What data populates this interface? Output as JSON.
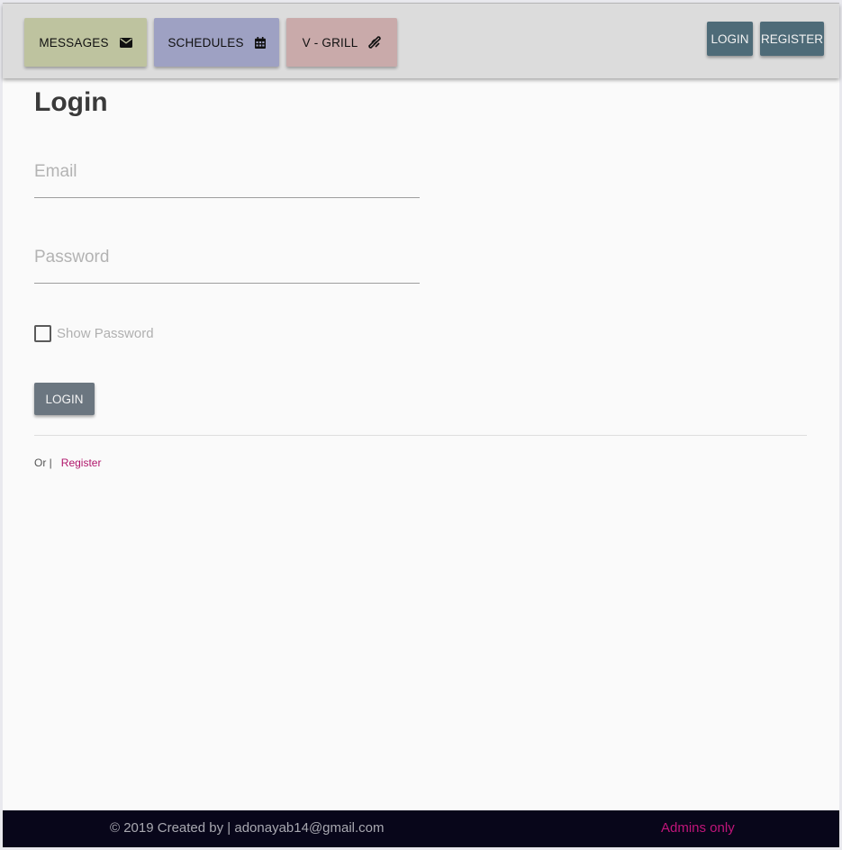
{
  "nav": {
    "messages_label": "MESSAGES",
    "messages_icon": "envelope-icon",
    "schedules_label": "SCHEDULES",
    "schedules_icon": "calendar-icon",
    "vgrill_label": "V - GRILL",
    "vgrill_icon": "grill-icon",
    "login_label": "LOGIN",
    "register_label": "REGISTER"
  },
  "form": {
    "title": "Login",
    "email_placeholder": "Email",
    "email_value": "",
    "password_placeholder": "Password",
    "password_value": "",
    "show_password_label": "Show Password",
    "show_password_checked": false,
    "submit_label": "LOGIN",
    "alt_prefix": "Or |",
    "alt_link": "Register"
  },
  "footer": {
    "credit": "© 2019 Created by | adonayab14@gmail.com",
    "admins_link": "Admins only"
  },
  "colors": {
    "messages_bg": "#bec39f",
    "schedules_bg": "#9ea1c3",
    "vgrill_bg": "#c9aaaa",
    "auth_button_bg": "#4e6b78",
    "submit_button_bg": "#6b7680",
    "link_color": "#b0166b",
    "footer_bg": "#08061a"
  }
}
